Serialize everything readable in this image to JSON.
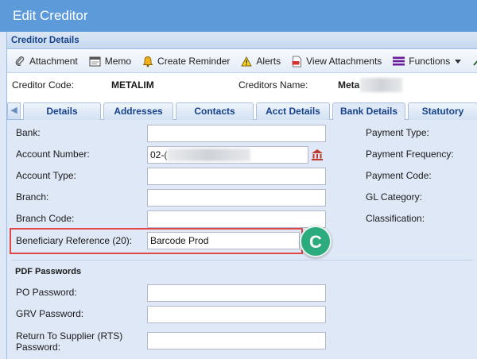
{
  "window": {
    "title": "Edit Creditor"
  },
  "panel": {
    "title": "Creditor Details"
  },
  "toolbar": {
    "attachment": "Attachment",
    "memo": "Memo",
    "create_reminder": "Create Reminder",
    "alerts": "Alerts",
    "view_attachments": "View Attachments",
    "functions": "Functions"
  },
  "info": {
    "creditor_code_label": "Creditor Code:",
    "creditor_code_value": "METALIM",
    "creditors_name_label": "Creditors Name:",
    "creditors_name_value": "Meta"
  },
  "tabs": [
    {
      "label": "Details"
    },
    {
      "label": "Addresses"
    },
    {
      "label": "Contacts"
    },
    {
      "label": "Acct Details"
    },
    {
      "label": "Bank Details"
    },
    {
      "label": "Statutory"
    }
  ],
  "active_tab": "Bank Details",
  "bank_form": {
    "bank_label": "Bank:",
    "bank_value": "",
    "account_number_label": "Account Number:",
    "account_number_value": "02-(",
    "account_type_label": "Account Type:",
    "account_type_value": "",
    "branch_label": "Branch:",
    "branch_value": "",
    "branch_code_label": "Branch Code:",
    "branch_code_value": "",
    "beneficiary_reference_label": "Beneficiary Reference (20):",
    "beneficiary_reference_value": "Barcode Prod"
  },
  "right_labels": {
    "payment_type": "Payment Type:",
    "payment_frequency": "Payment Frequency:",
    "payment_code": "Payment Code:",
    "gl_category": "GL Category:",
    "classification": "Classification:"
  },
  "annotation": {
    "badge_letter": "C"
  },
  "pdf_passwords": {
    "section_title": "PDF Passwords",
    "po_password_label": "PO Password:",
    "grv_password_label": "GRV Password:",
    "rts_password_label_line1": "Return To Supplier (RTS)",
    "rts_password_label_line2": "Password:"
  },
  "colors": {
    "titlebar": "#5d9ad9",
    "panel_bg": "#dfe8f6",
    "highlight_border": "#e04848",
    "badge": "#2cab7e"
  }
}
